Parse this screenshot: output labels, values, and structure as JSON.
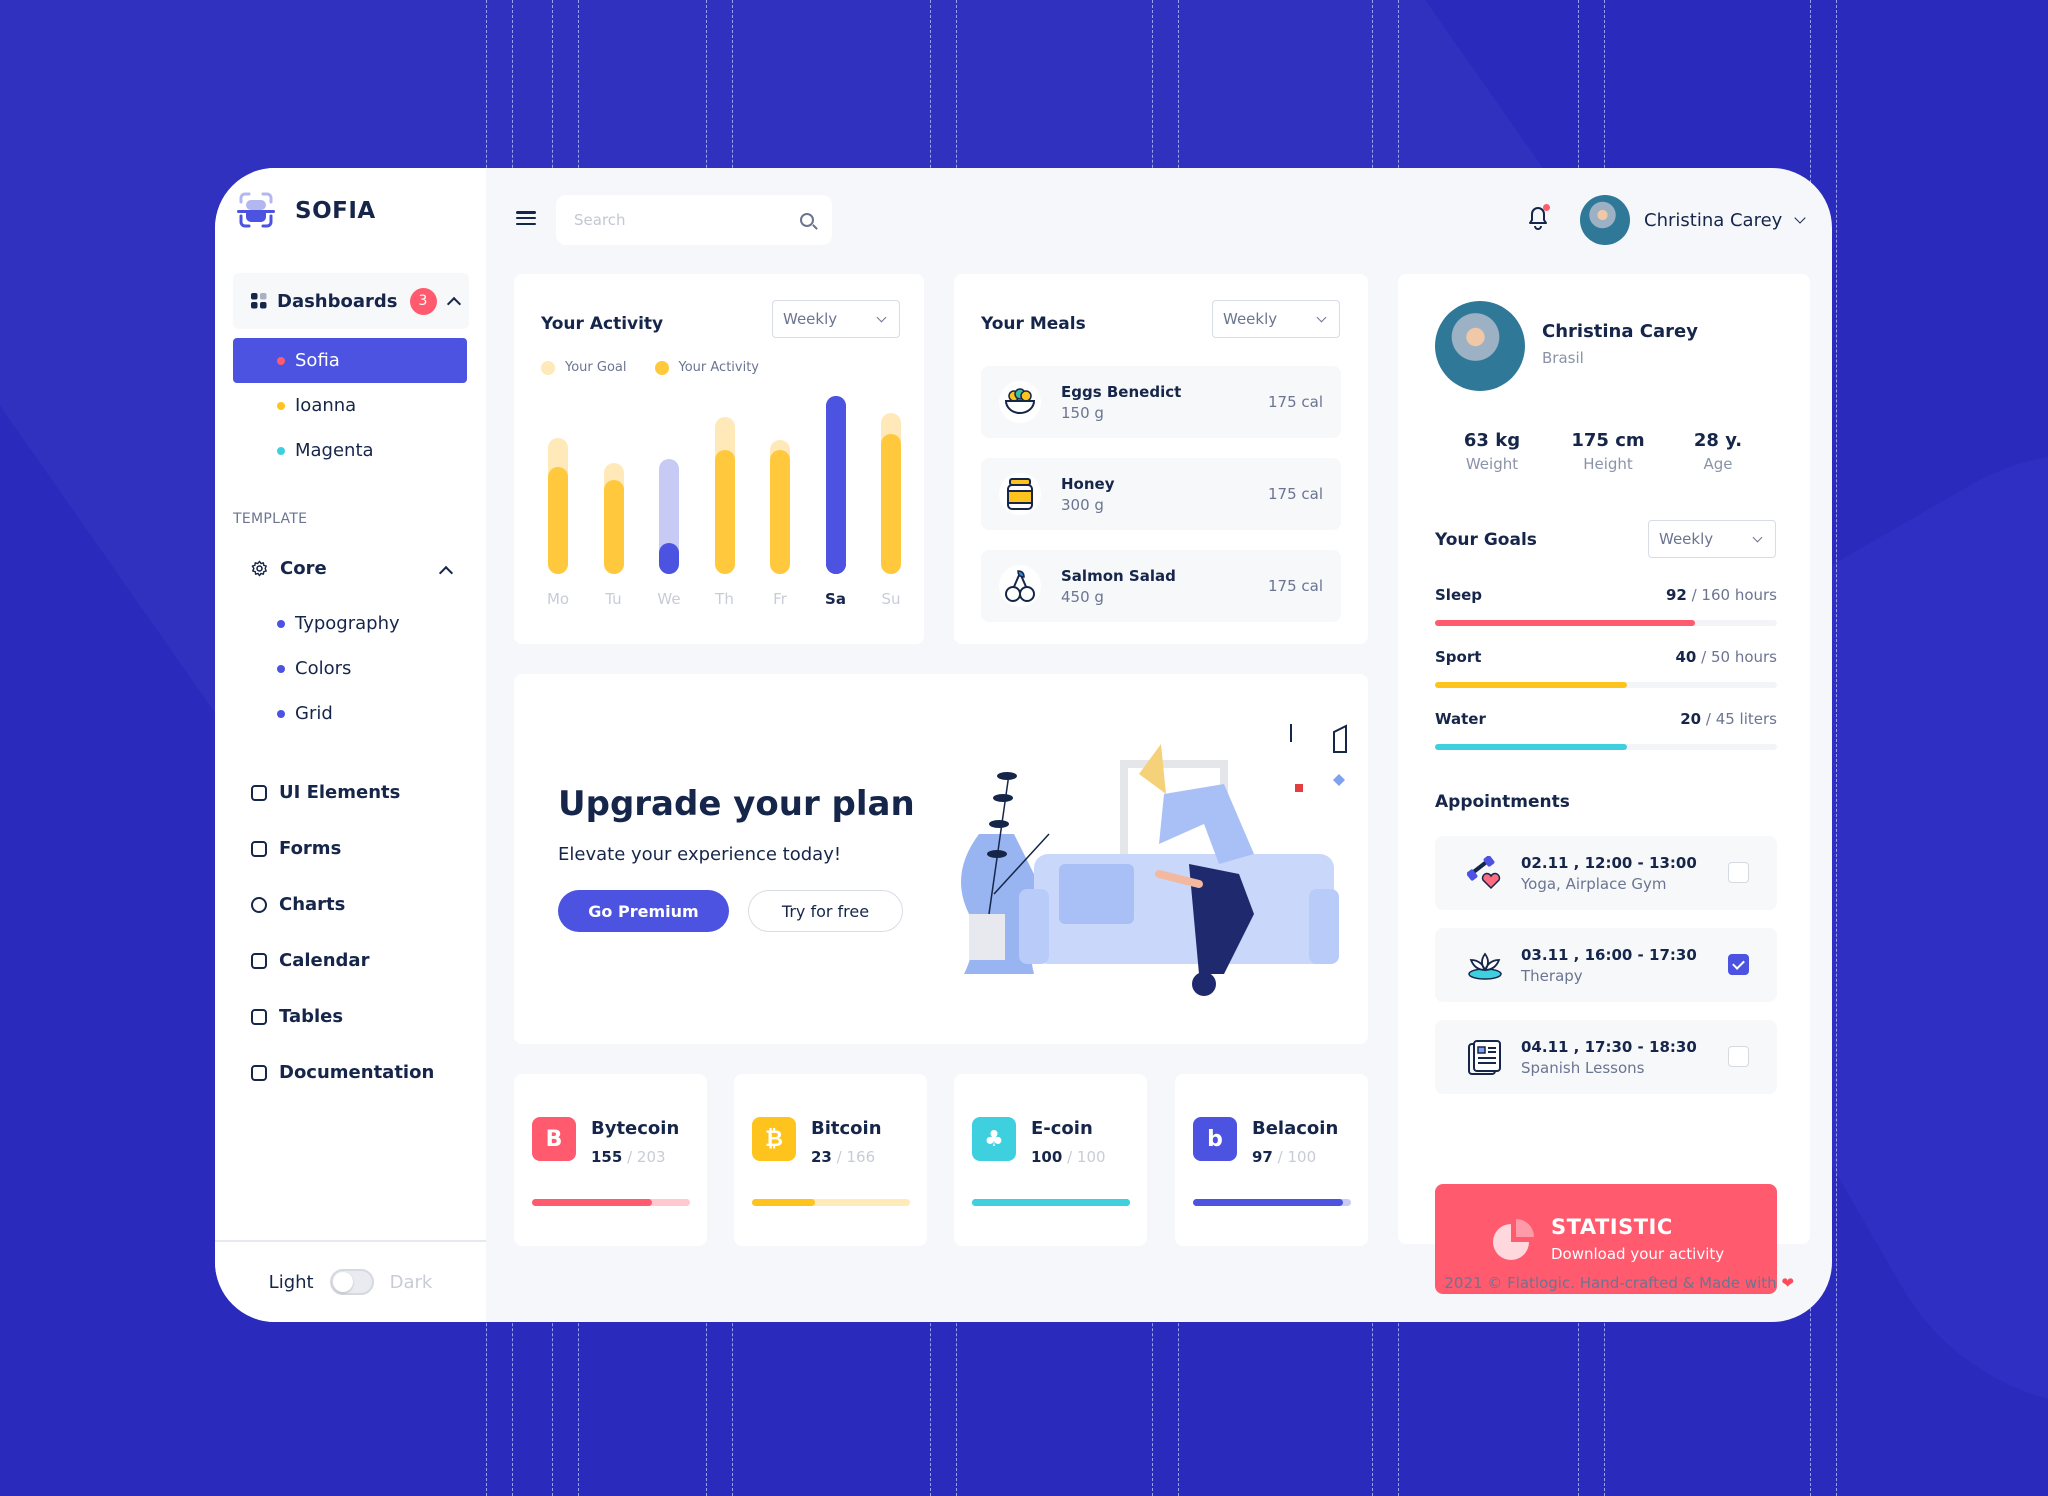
{
  "brand": {
    "name": "SOFIA"
  },
  "sidebar": {
    "dashboards": {
      "label": "Dashboards",
      "badge": "3"
    },
    "dashboard_items": [
      {
        "label": "Sofia",
        "dot_color": "#ff5a6e",
        "active": true
      },
      {
        "label": "Ioanna",
        "dot_color": "#ffc31e",
        "active": false
      },
      {
        "label": "Magenta",
        "dot_color": "#3fd0e0",
        "active": false
      }
    ],
    "section_label": "TEMPLATE",
    "core": {
      "label": "Core"
    },
    "core_items": [
      {
        "label": "Typography"
      },
      {
        "label": "Colors"
      },
      {
        "label": "Grid"
      }
    ],
    "menu": [
      {
        "label": "UI Elements",
        "icon": "ui-elements-icon"
      },
      {
        "label": "Forms",
        "icon": "forms-icon"
      },
      {
        "label": "Charts",
        "icon": "charts-icon"
      },
      {
        "label": "Calendar",
        "icon": "calendar-icon"
      },
      {
        "label": "Tables",
        "icon": "tables-icon"
      },
      {
        "label": "Documentation",
        "icon": "documentation-icon"
      }
    ],
    "theme": {
      "light": "Light",
      "dark": "Dark",
      "is_dark": false
    }
  },
  "header": {
    "search_placeholder": "Search",
    "search_value": "",
    "user_name": "Christina Carey",
    "notifications_unread": true
  },
  "activity": {
    "title": "Your Activity",
    "period": "Weekly",
    "legend": {
      "goal": "Your Goal",
      "activity": "Your Activity"
    }
  },
  "chart_data": {
    "type": "bar",
    "title": "Your Activity",
    "categories": [
      "Mo",
      "Tu",
      "We",
      "Th",
      "Fr",
      "Sa",
      "Su"
    ],
    "highlighted_category": "Sa",
    "series": [
      {
        "name": "Your Goal",
        "color": "#ffe9b8",
        "values": [
          65,
          53,
          55,
          75,
          64,
          85,
          77
        ]
      },
      {
        "name": "Your Activity",
        "color": "#ffc83d",
        "values": [
          51,
          45,
          15,
          59,
          59,
          85,
          67
        ]
      }
    ],
    "ylim": [
      0,
      85
    ],
    "grid": false,
    "legend": "top-left"
  },
  "meals": {
    "title": "Your Meals",
    "period": "Weekly",
    "items": [
      {
        "name": "Eggs Benedict",
        "weight": "150 g",
        "calories": "175 cal",
        "icon": "eggs-bowl-icon"
      },
      {
        "name": "Honey",
        "weight": "300 g",
        "calories": "175 cal",
        "icon": "honey-jar-icon"
      },
      {
        "name": "Salmon Salad",
        "weight": "450 g",
        "calories": "175 cal",
        "icon": "cherries-icon"
      }
    ]
  },
  "upgrade": {
    "title": "Upgrade your plan",
    "subtitle": "Elevate your experience today!",
    "primary": "Go Premium",
    "secondary": "Try for free"
  },
  "coins": [
    {
      "name": "Bytecoin",
      "value": "155",
      "total": "203",
      "fraction": 0.76,
      "color": "#ff5a6e",
      "track": "#ffc9d0",
      "glyph": "B"
    },
    {
      "name": "Bitcoin",
      "value": "23",
      "total": "166",
      "fraction": 0.4,
      "color": "#ffc31e",
      "track": "#ffeab8",
      "glyph": "₿"
    },
    {
      "name": "E-coin",
      "value": "100",
      "total": "100",
      "fraction": 1.0,
      "color": "#3fd0e0",
      "track": "#3fd0e0",
      "glyph": "♣"
    },
    {
      "name": "Belacoin",
      "value": "97",
      "total": "100",
      "fraction": 0.95,
      "color": "#4b53e0",
      "track": "#c9cbf5",
      "glyph": "b"
    }
  ],
  "profile": {
    "name": "Christina Carey",
    "country": "Brasil",
    "stats": [
      {
        "value": "63 kg",
        "label": "Weight"
      },
      {
        "value": "175 cm",
        "label": "Height"
      },
      {
        "value": "28 y.",
        "label": "Age"
      }
    ]
  },
  "goals": {
    "title": "Your Goals",
    "period": "Weekly",
    "items": [
      {
        "label": "Sleep",
        "value": "92",
        "total": "160 hours",
        "fraction": 0.76,
        "color": "#ff5a6e"
      },
      {
        "label": "Sport",
        "value": "40",
        "total": "50 hours",
        "fraction": 0.56,
        "color": "#ffc31e"
      },
      {
        "label": "Water",
        "value": "20",
        "total": "45 liters",
        "fraction": 0.56,
        "color": "#3fd0e0"
      }
    ]
  },
  "appointments": {
    "title": "Appointments",
    "items": [
      {
        "time": "02.11 , 12:00 - 13:00",
        "desc": "Yoga, Airplace Gym",
        "checked": false,
        "icon": "dumbbell-heart-icon"
      },
      {
        "time": "03.11 , 16:00 - 17:30",
        "desc": "Therapy",
        "checked": true,
        "icon": "lotus-icon"
      },
      {
        "time": "04.11 , 17:30 - 18:30",
        "desc": "Spanish Lessons",
        "checked": false,
        "icon": "newspaper-icon"
      }
    ]
  },
  "statistic": {
    "title": "STATISTIC",
    "subtitle": "Download your activity"
  },
  "footer": {
    "text": "2021 © Flatlogic. Hand-crafted & Made with",
    "heart": "❤"
  },
  "colors": {
    "primary": "#4b53e0",
    "danger": "#ff5a6e",
    "warning": "#ffc31e",
    "info": "#3fd0e0",
    "text": "#16264a",
    "background": "#2a2bbd"
  }
}
